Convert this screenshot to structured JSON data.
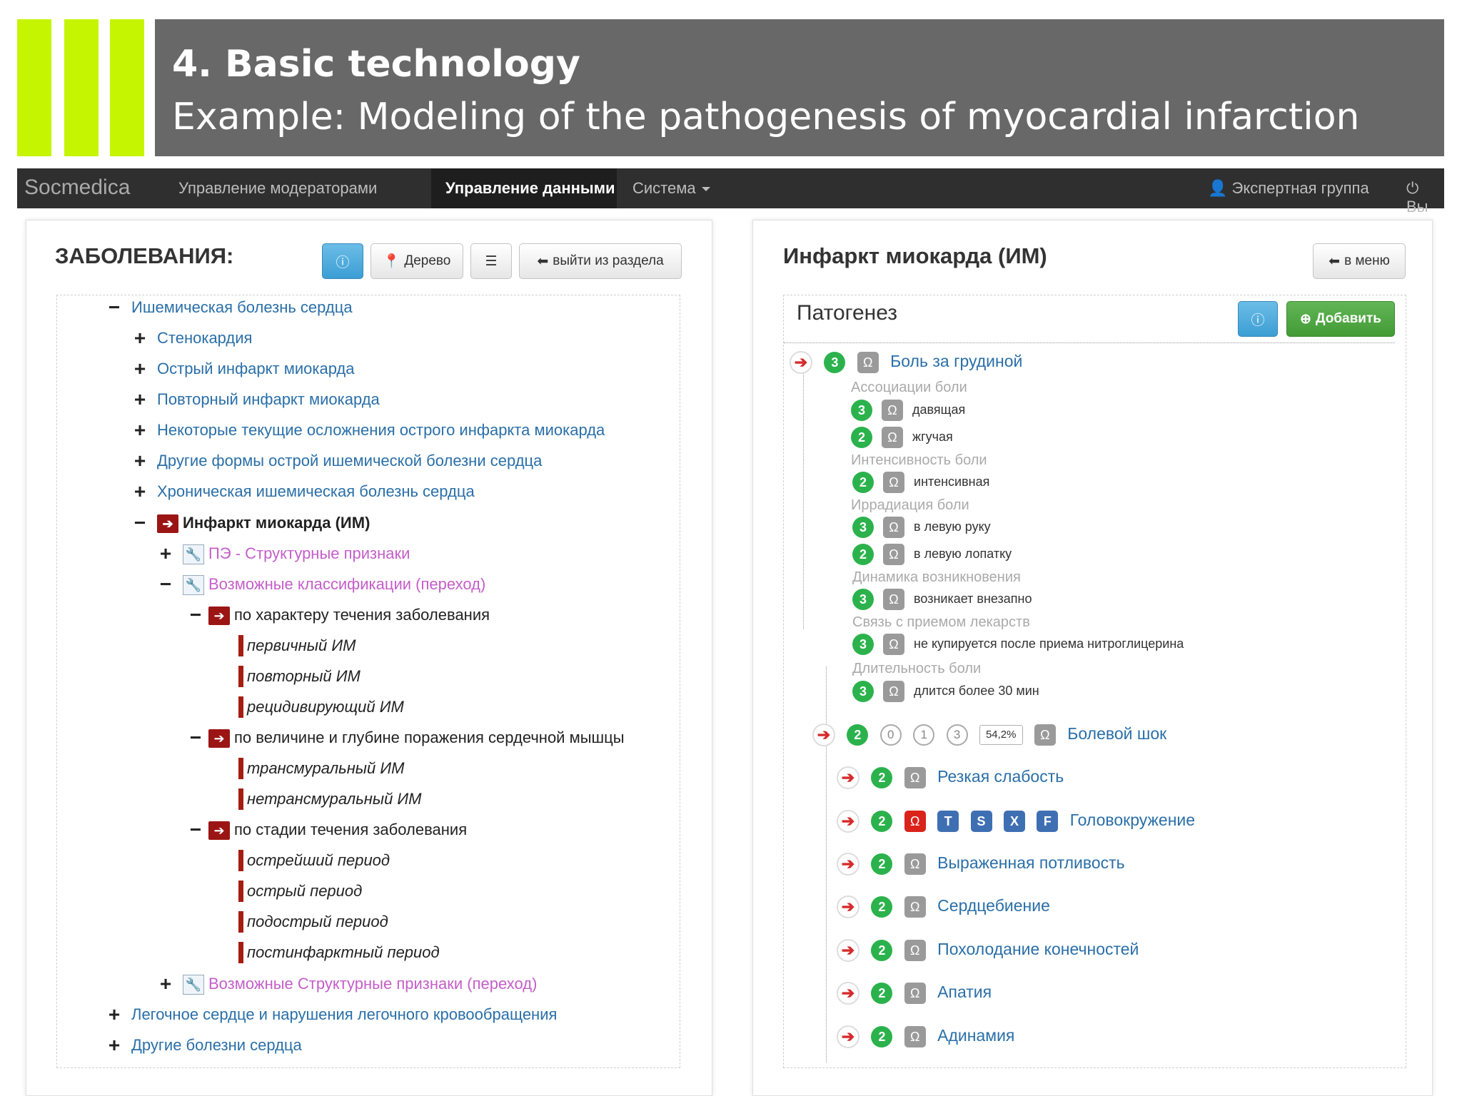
{
  "slide": {
    "title": "4. Basic technology",
    "subtitle": "Example: Modeling of the pathogenesis of myocardial infarction",
    "accent_color": "#c6f500",
    "header_bg": "#686868"
  },
  "navbar": {
    "brand": "Socmedica",
    "items": [
      "Управление модераторами",
      "Управление данными",
      "Система"
    ],
    "active_item": "Управление данными",
    "user": "Экспертная группа",
    "logout_fragment": "Вы"
  },
  "left_panel": {
    "title": "ЗАБОЛЕВАНИЯ:",
    "buttons": {
      "tree": "Дерево",
      "exit": "выйти из раздела"
    },
    "tree": [
      {
        "sign": "−",
        "label": "Ишемическая болезнь сердца"
      },
      {
        "sign": "+",
        "label": "Стенокардия"
      },
      {
        "sign": "+",
        "label": "Острый инфаркт миокарда"
      },
      {
        "sign": "+",
        "label": "Повторный инфаркт миокарда"
      },
      {
        "sign": "+",
        "label": "Некоторые текущие осложнения острого инфаркта миокарда"
      },
      {
        "sign": "+",
        "label": "Другие формы острой ишемической болезни сердца"
      },
      {
        "sign": "+",
        "label": "Хроническая ишемическая болезнь сердца"
      },
      {
        "sign": "−",
        "label": "Инфаркт миокарда (ИМ)"
      },
      {
        "sign": "+",
        "label": "ПЭ - Структурные признаки"
      },
      {
        "sign": "−",
        "label": "Возможные классификации (переход)"
      },
      {
        "sign": "−",
        "label": "по характеру течения заболевания"
      },
      {
        "label": "первичный ИМ"
      },
      {
        "label": "повторный ИМ"
      },
      {
        "label": "рецидивирующий ИМ"
      },
      {
        "sign": "−",
        "label": "по величине и глубине поражения сердечной мышцы"
      },
      {
        "label": "трансмуральный ИМ"
      },
      {
        "label": "нетрансмуральный ИМ"
      },
      {
        "sign": "−",
        "label": "по стадии течения заболевания"
      },
      {
        "label": "острейший период"
      },
      {
        "label": "острый период"
      },
      {
        "label": "подострый период"
      },
      {
        "label": "постинфарктный период"
      },
      {
        "sign": "+",
        "label": "Возможные Структурные признаки (переход)"
      },
      {
        "sign": "+",
        "label": "Легочное сердце и нарушения легочного кровообращения"
      },
      {
        "sign": "+",
        "label": "Другие болезни сердца"
      }
    ]
  },
  "right_panel": {
    "title": "Инфаркт миокарда (ИМ)",
    "back_button": "в меню",
    "section_title": "Патогенез",
    "add_button": "Добавить",
    "omega": "Ω",
    "chest_pain": {
      "badge": "3",
      "label": "Боль за грудиной",
      "groups": [
        {
          "name": "Ассоциации боли",
          "items": [
            {
              "badge": "3",
              "text": "давящая"
            },
            {
              "badge": "2",
              "text": "жгучая"
            }
          ]
        },
        {
          "name": "Интенсивность боли",
          "items": [
            {
              "badge": "2",
              "text": "интенсивная"
            }
          ]
        },
        {
          "name": "Иррадиация боли",
          "items": [
            {
              "badge": "3",
              "text": "в левую руку"
            },
            {
              "badge": "2",
              "text": "в левую лопатку"
            }
          ]
        },
        {
          "name": "Динамика возникновения",
          "items": [
            {
              "badge": "3",
              "text": "возникает внезапно"
            }
          ]
        },
        {
          "name": "Связь с приемом лекарств",
          "items": [
            {
              "badge": "3",
              "text": "не купируется после приема нитроглицерина"
            }
          ]
        },
        {
          "name": "Длительность боли",
          "items": [
            {
              "badge": "3",
              "text": "длится более 30 мин"
            }
          ]
        }
      ]
    },
    "shock": {
      "badge": "2",
      "options": [
        "0",
        "1",
        "3"
      ],
      "percent": "54,2%",
      "label": "Болевой шок"
    },
    "symptoms": [
      {
        "badge": "2",
        "label": "Резкая слабость"
      },
      {
        "badge": "2",
        "label": "Головокружение",
        "tags": [
          "T",
          "S",
          "X",
          "F"
        ],
        "omega_red": true
      },
      {
        "badge": "2",
        "label": "Выраженная потливость"
      },
      {
        "badge": "2",
        "label": "Сердцебиение"
      },
      {
        "badge": "2",
        "label": "Похолодание конечностей"
      },
      {
        "badge": "2",
        "label": "Апатия"
      },
      {
        "badge": "2",
        "label": "Адинамия"
      }
    ]
  }
}
